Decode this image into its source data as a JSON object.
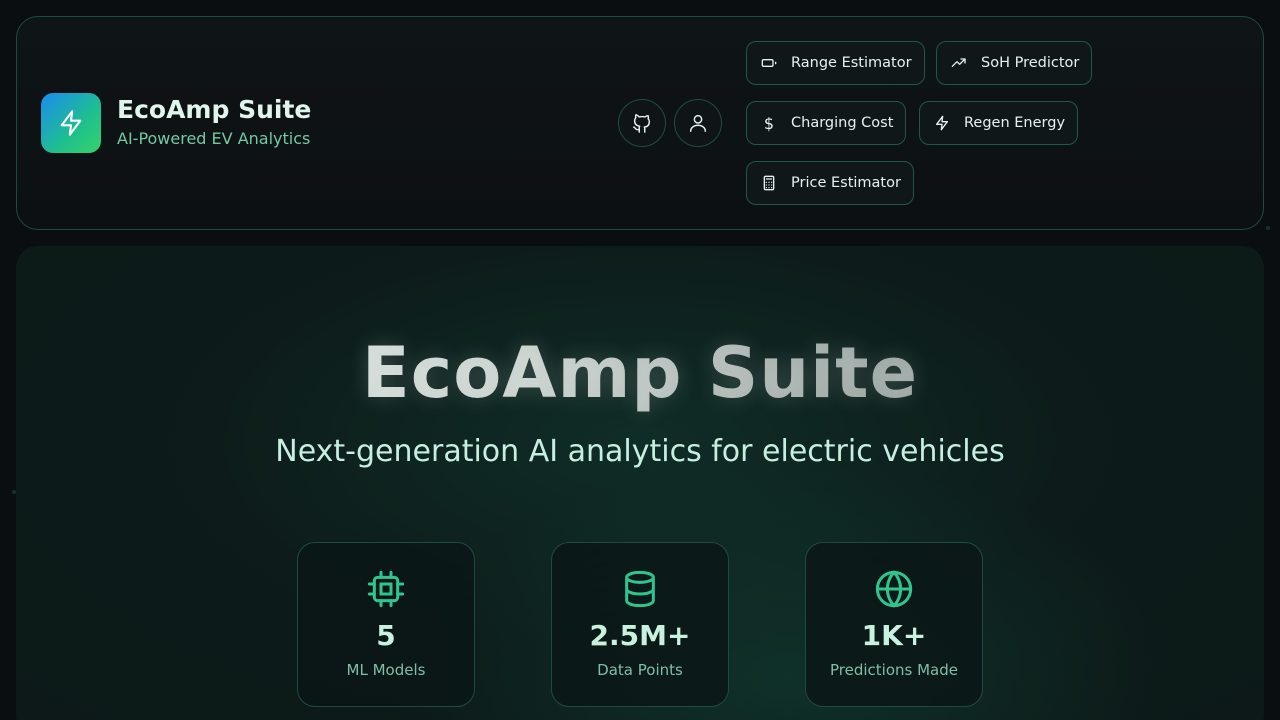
{
  "brand": {
    "title": "EcoAmp Suite",
    "subtitle": "AI-Powered EV Analytics"
  },
  "header_buttons": [
    {
      "name": "github-button",
      "icon": "github-icon"
    },
    {
      "name": "user-button",
      "icon": "user-icon"
    }
  ],
  "nav": [
    {
      "label": "Range Estimator",
      "icon": "battery-icon"
    },
    {
      "label": "SoH Predictor",
      "icon": "trending-up-icon"
    },
    {
      "label": "Charging Cost",
      "icon": "dollar-icon"
    },
    {
      "label": "Regen Energy",
      "icon": "bolt-icon"
    },
    {
      "label": "Price Estimator",
      "icon": "calculator-icon"
    }
  ],
  "hero": {
    "title": "EcoAmp Suite",
    "subtitle": "Next-generation AI analytics for electric vehicles"
  },
  "stats": [
    {
      "value": "5",
      "label": "ML Models",
      "icon": "cpu-icon"
    },
    {
      "value": "2.5M+",
      "label": "Data Points",
      "icon": "database-icon"
    },
    {
      "value": "1K+",
      "label": "Predictions Made",
      "icon": "globe-icon"
    }
  ],
  "colors": {
    "accent": "#2fc58f",
    "border": "#1d4b42",
    "background": "#0b0e10"
  }
}
